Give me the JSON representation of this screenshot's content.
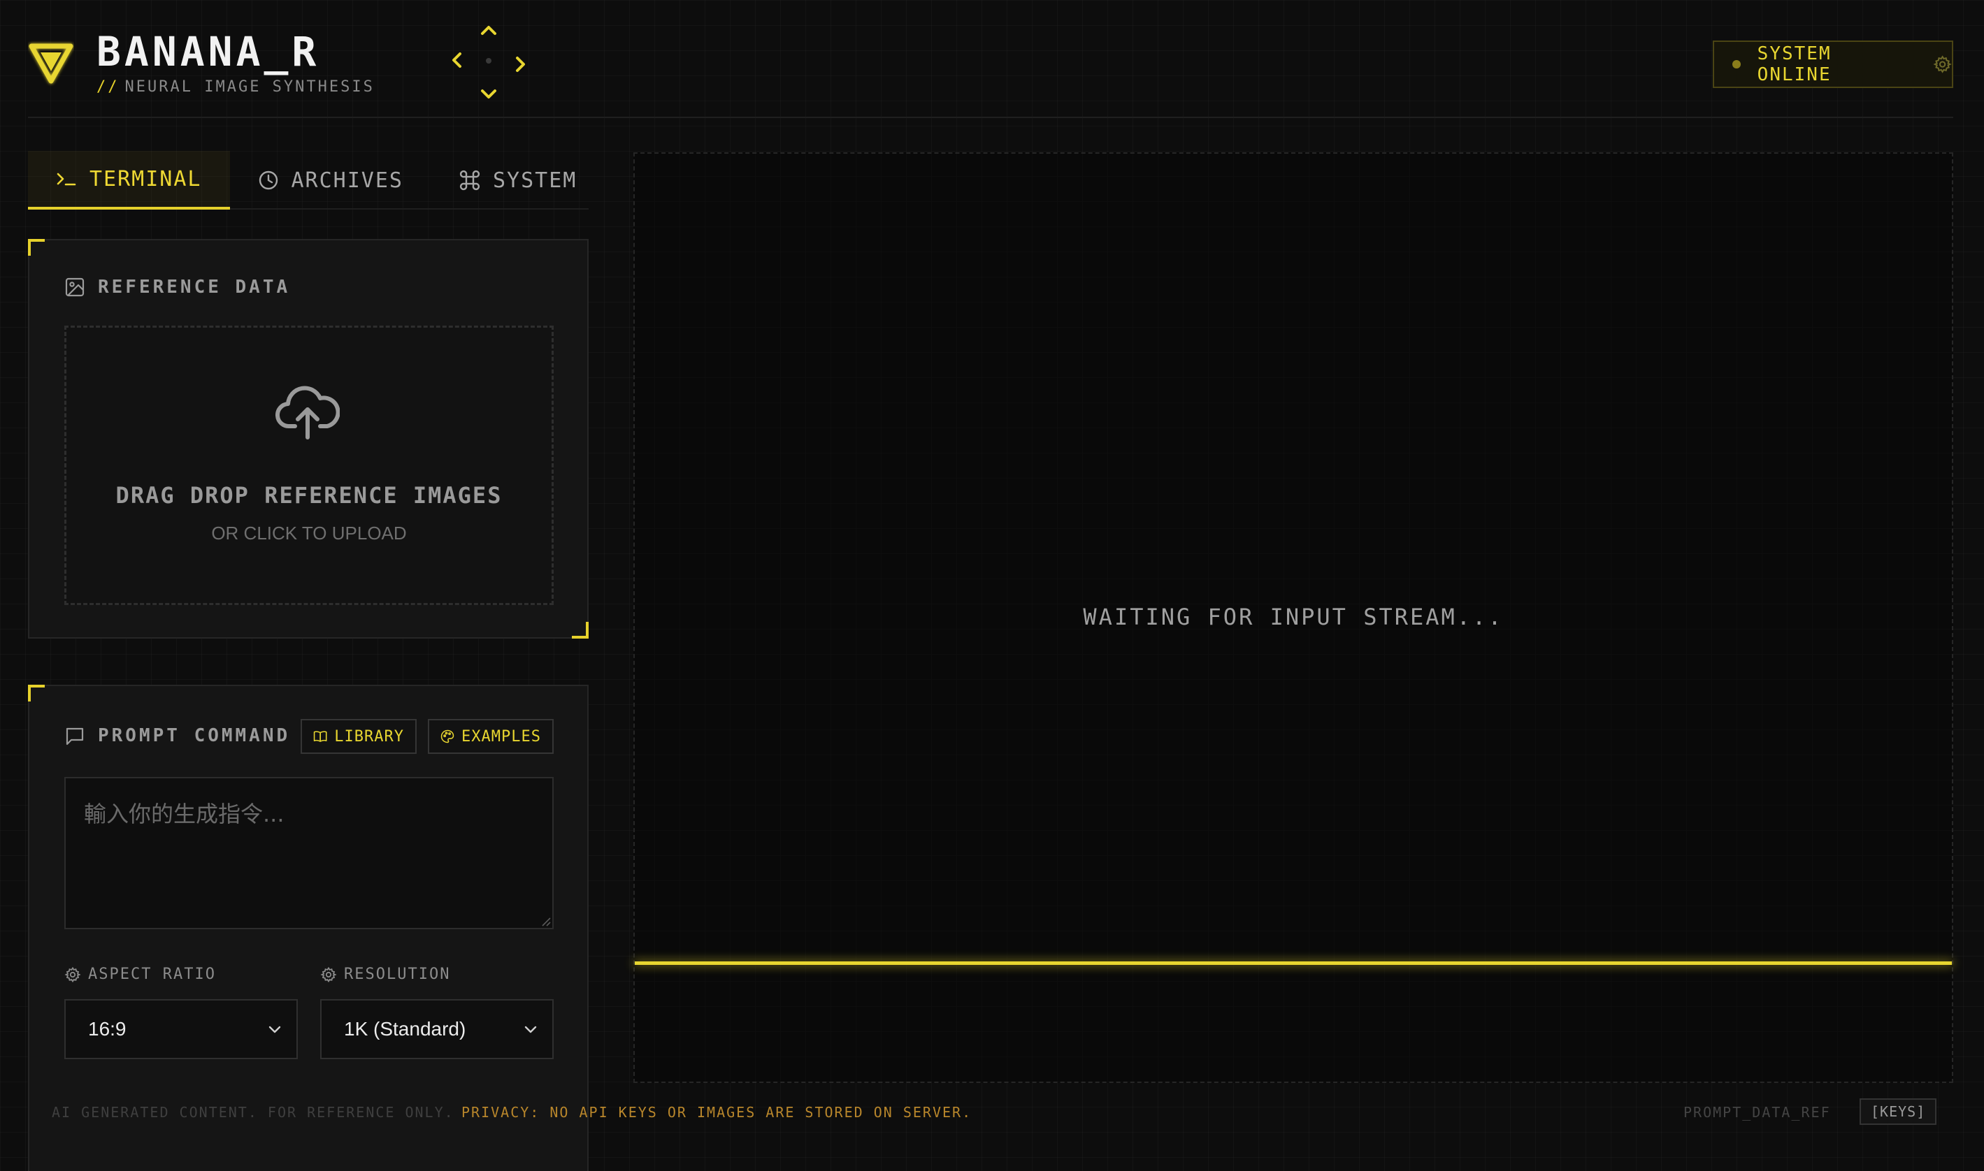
{
  "header": {
    "title": "BANANA_R",
    "subtitle_prefix": "//",
    "subtitle": "NEURAL IMAGE SYNTHESIS",
    "logo_icon": "triangle-logo-icon",
    "status_label": "SYSTEM ONLINE",
    "accent_color": "#e8d630"
  },
  "tabs": [
    {
      "label": "TERMINAL",
      "icon": "terminal-prompt-icon",
      "active": true
    },
    {
      "label": "ARCHIVES",
      "icon": "clock-icon",
      "active": false
    },
    {
      "label": "SYSTEM",
      "icon": "command-key-icon",
      "active": false
    }
  ],
  "reference": {
    "label": "REFERENCE DATA",
    "drop_title": "DRAG DROP REFERENCE IMAGES",
    "drop_subtitle": "OR CLICK TO UPLOAD"
  },
  "prompt": {
    "label": "PROMPT COMMAND",
    "library_label": "LIBRARY",
    "examples_label": "EXAMPLES",
    "placeholder": "輸入你的生成指令...",
    "aspect_label": "ASPECT RATIO",
    "aspect_value": "16:9",
    "resolution_label": "RESOLUTION",
    "resolution_value": "1K (Standard)"
  },
  "output": {
    "waiting_text": "WAITING FOR INPUT STREAM..."
  },
  "footer": {
    "disclaimer": "AI GENERATED CONTENT. FOR REFERENCE ONLY.",
    "privacy": "PRIVACY: NO API KEYS OR IMAGES ARE STORED ON SERVER.",
    "ref_label": "PROMPT_DATA_REF",
    "keys_label": "[KEYS]"
  }
}
